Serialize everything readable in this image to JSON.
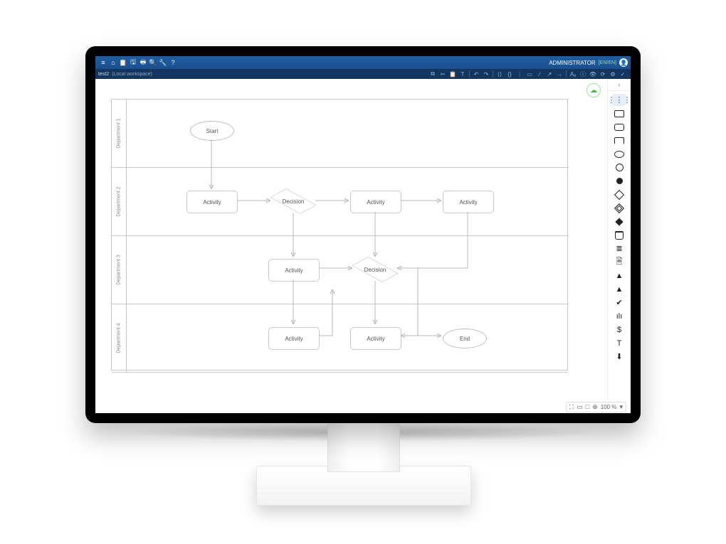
{
  "user": {
    "name": "ADMINISTRATOR",
    "lang": "[EN/EN]"
  },
  "doc": {
    "name": "test2",
    "workspace": "(Local workspace)"
  },
  "menu": {
    "items": [
      {
        "id": "menu",
        "glyph": "≡"
      },
      {
        "id": "home",
        "glyph": "⌂"
      },
      {
        "id": "clipboard",
        "glyph": "📋"
      },
      {
        "id": "save",
        "glyph": "🖫"
      },
      {
        "id": "print",
        "glyph": "🖶"
      },
      {
        "id": "search",
        "glyph": "🔍"
      },
      {
        "id": "tools",
        "glyph": "🔧"
      },
      {
        "id": "help",
        "glyph": "?"
      }
    ]
  },
  "toolbar": {
    "items": [
      {
        "id": "copy",
        "glyph": "⧉"
      },
      {
        "id": "cut",
        "glyph": "✂"
      },
      {
        "id": "paste",
        "glyph": "📋"
      },
      {
        "id": "format",
        "glyph": "T"
      },
      {
        "id": "sep1",
        "sep": true
      },
      {
        "id": "undo",
        "glyph": "↶"
      },
      {
        "id": "redo",
        "glyph": "↷"
      },
      {
        "id": "sep2",
        "sep": true
      },
      {
        "id": "code",
        "glyph": "⟨⟩"
      },
      {
        "id": "brackets",
        "glyph": "{}"
      },
      {
        "id": "align",
        "glyph": "⋮"
      },
      {
        "id": "hrule",
        "glyph": "▭"
      },
      {
        "id": "line",
        "glyph": "∕"
      },
      {
        "id": "connector",
        "glyph": "↗"
      },
      {
        "id": "arrow",
        "glyph": "→"
      },
      {
        "id": "sep3",
        "sep": true
      },
      {
        "id": "textstyle",
        "glyph": "Aₐ"
      },
      {
        "id": "info",
        "glyph": "ⓘ"
      },
      {
        "id": "visibility",
        "glyph": "👁"
      },
      {
        "id": "refresh",
        "glyph": "⟳"
      },
      {
        "id": "settings",
        "glyph": "⚙"
      },
      {
        "id": "check",
        "glyph": "✓"
      }
    ]
  },
  "lanes": [
    {
      "label": "Department 1"
    },
    {
      "label": "Department 2"
    },
    {
      "label": "Department 3"
    },
    {
      "label": "Department 4"
    }
  ],
  "nodes": {
    "start": "Start",
    "act1": "Activity",
    "act2": "Activity",
    "act3": "Activity",
    "act4": "Activity",
    "act5": "Activity",
    "act6": "Activity",
    "dec1": "Decision",
    "dec2": "Decision",
    "end": "End"
  },
  "shapes": [
    {
      "id": "grid",
      "cls": "sel",
      "glyph": "⋮⋮⋮"
    },
    {
      "id": "rect",
      "cls": "",
      "shape": "sb-rect"
    },
    {
      "id": "rrect",
      "cls": "",
      "shape": "sb-rrect"
    },
    {
      "id": "openrect",
      "cls": "",
      "shape": "sb-open-rect"
    },
    {
      "id": "oval",
      "cls": "",
      "shape": "sb-oval"
    },
    {
      "id": "circle",
      "cls": "",
      "shape": "sb-circ"
    },
    {
      "id": "fcircle",
      "cls": "",
      "shape": "sb-circ-f"
    },
    {
      "id": "diamond",
      "cls": "",
      "shape": "sb-dia"
    },
    {
      "id": "ddiamond",
      "cls": "",
      "shape": "sb-dia-d"
    },
    {
      "id": "fdiamond",
      "cls": "",
      "shape": "sb-dia-f"
    },
    {
      "id": "database",
      "cls": "",
      "shape": "sb-db"
    },
    {
      "id": "list",
      "cls": "",
      "glyph": "≣"
    },
    {
      "id": "doc",
      "cls": "",
      "glyph": "🗎"
    },
    {
      "id": "person",
      "cls": "",
      "glyph": "▲"
    },
    {
      "id": "tri",
      "cls": "",
      "glyph": "▲"
    },
    {
      "id": "clock",
      "cls": "",
      "glyph": "✔"
    },
    {
      "id": "chart",
      "cls": "",
      "glyph": "ılı"
    },
    {
      "id": "dollar",
      "cls": "",
      "glyph": "$"
    },
    {
      "id": "text",
      "cls": "",
      "glyph": "T"
    },
    {
      "id": "pin",
      "cls": "",
      "glyph": "⬇"
    }
  ],
  "status": {
    "zoom": "100 %"
  }
}
